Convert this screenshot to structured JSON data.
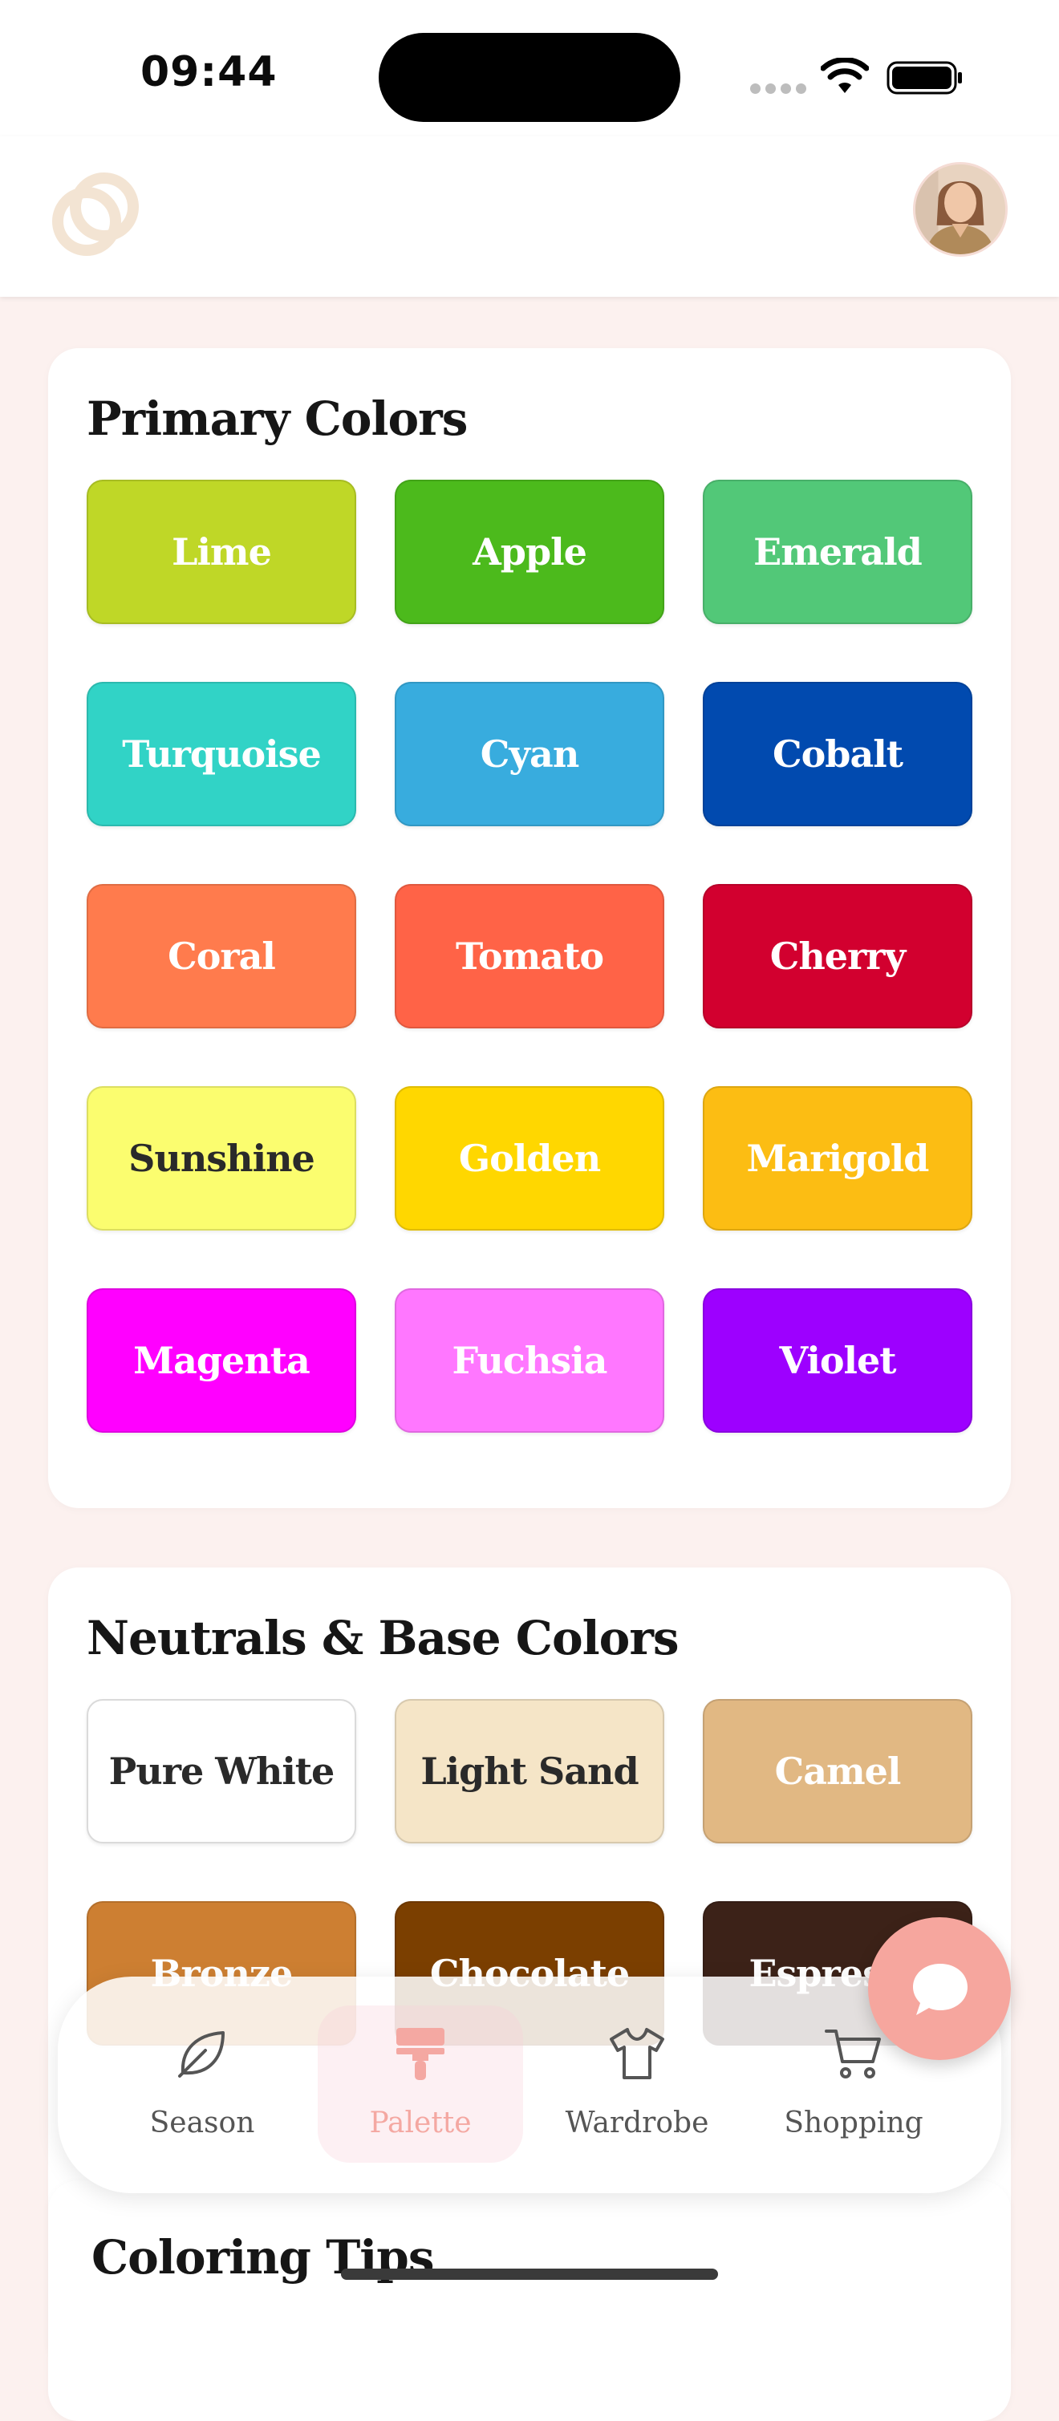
{
  "status_bar": {
    "time": "09:44"
  },
  "header": {
    "logo_icon": "interlocking-rings-icon",
    "avatar_alt": "user-avatar"
  },
  "primary_colors": {
    "title": "Primary Colors",
    "swatches": [
      {
        "label": "Lime",
        "color": "#BFD727",
        "text_color": "#FFFFFF"
      },
      {
        "label": "Apple",
        "color": "#4CBA1C",
        "text_color": "#FFFFFF"
      },
      {
        "label": "Emerald",
        "color": "#52C878",
        "text_color": "#FFFFFF"
      },
      {
        "label": "Turquoise",
        "color": "#31D3C6",
        "text_color": "#FFFFFF"
      },
      {
        "label": "Cyan",
        "color": "#38ACDE",
        "text_color": "#FFFFFF"
      },
      {
        "label": "Cobalt",
        "color": "#014AAF",
        "text_color": "#FFFFFF"
      },
      {
        "label": "Coral",
        "color": "#FF7B4D",
        "text_color": "#FFFFFF"
      },
      {
        "label": "Tomato",
        "color": "#FF6347",
        "text_color": "#FFFFFF"
      },
      {
        "label": "Cherry",
        "color": "#D2002F",
        "text_color": "#FFFFFF"
      },
      {
        "label": "Sunshine",
        "color": "#FBFD6F",
        "text_color": "#2A2A2A"
      },
      {
        "label": "Golden",
        "color": "#FFD700",
        "text_color": "#FFFFFF"
      },
      {
        "label": "Marigold",
        "color": "#FCBD13",
        "text_color": "#FFFFFF"
      },
      {
        "label": "Magenta",
        "color": "#FF00FF",
        "text_color": "#FFFFFF"
      },
      {
        "label": "Fuchsia",
        "color": "#FF77FF",
        "text_color": "#FFFFFF"
      },
      {
        "label": "Violet",
        "color": "#9D00FF",
        "text_color": "#FFFFFF"
      }
    ]
  },
  "neutrals": {
    "title": "Neutrals & Base Colors",
    "swatches": [
      {
        "label": "Pure White",
        "color": "#FFFFFF",
        "text_color": "#2A2A2A"
      },
      {
        "label": "Light Sand",
        "color": "#F5E5C7",
        "text_color": "#2A2A2A"
      },
      {
        "label": "Camel",
        "color": "#E1B883",
        "text_color": "#FFFFFF"
      },
      {
        "label": "Bronze",
        "color": "#CD7F32",
        "text_color": "#FFFFFF"
      },
      {
        "label": "Chocolate",
        "color": "#7B3F00",
        "text_color": "#FFFFFF"
      },
      {
        "label": "Espresso",
        "color": "#3C2218",
        "text_color": "#FFFFFF"
      }
    ]
  },
  "tips": {
    "title": "Coloring Tips"
  },
  "bottom_nav": {
    "items": [
      {
        "label": "Season",
        "icon": "leaf-icon",
        "active": false
      },
      {
        "label": "Palette",
        "icon": "paint-roller-icon",
        "active": true
      },
      {
        "label": "Wardrobe",
        "icon": "tshirt-icon",
        "active": false
      },
      {
        "label": "Shopping",
        "icon": "shopping-cart-icon",
        "active": false
      }
    ],
    "active_color": "#F4A8A2"
  },
  "chat_fab": {
    "icon": "chat-bubble-icon",
    "color": "#F6A69E"
  }
}
